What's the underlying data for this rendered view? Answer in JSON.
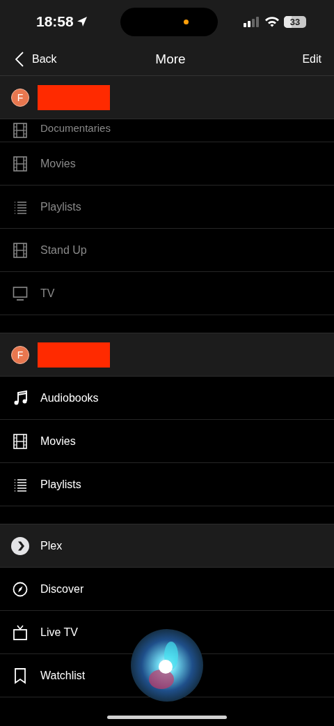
{
  "status_bar": {
    "time": "18:58",
    "battery": "33"
  },
  "nav": {
    "back": "Back",
    "title": "More",
    "action": "Edit"
  },
  "sections": [
    {
      "kind": "server",
      "avatar": "F",
      "redacted": true,
      "dimmed": true,
      "items": [
        {
          "label": "Documentaries",
          "kind": "film",
          "partial": true
        },
        {
          "label": "Movies",
          "kind": "film"
        },
        {
          "label": "Playlists",
          "kind": "list"
        },
        {
          "label": "Stand Up",
          "kind": "film"
        },
        {
          "label": "TV",
          "kind": "monitor"
        }
      ]
    },
    {
      "kind": "server",
      "avatar": "F",
      "redacted": true,
      "dimmed": false,
      "items": [
        {
          "label": "Audiobooks",
          "kind": "music"
        },
        {
          "label": "Movies",
          "kind": "film"
        },
        {
          "label": "Playlists",
          "kind": "list"
        }
      ]
    },
    {
      "kind": "plex",
      "title": "Plex",
      "dimmed": false,
      "items": [
        {
          "label": "Discover",
          "kind": "compass"
        },
        {
          "label": "Live TV",
          "kind": "tv"
        },
        {
          "label": "Watchlist",
          "kind": "bookmark"
        }
      ]
    }
  ]
}
